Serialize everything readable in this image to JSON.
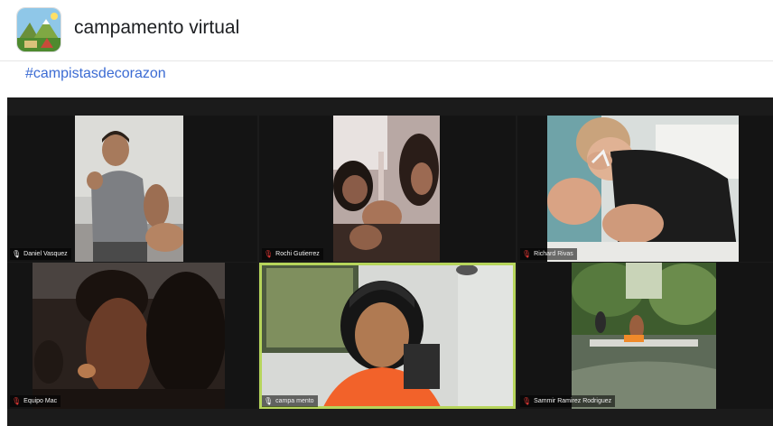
{
  "page": {
    "title": "campamento virtual",
    "hashtag": "#campistasdecorazon",
    "avatar_icon": "campsite-logo-icon"
  },
  "meeting": {
    "participants": [
      {
        "name": "Daniel Vasquez",
        "muted": false,
        "active": false
      },
      {
        "name": "Rochi Gutierrez",
        "muted": true,
        "active": false
      },
      {
        "name": "Richard Rivas",
        "muted": true,
        "active": false
      },
      {
        "name": "Equipo Mac",
        "muted": true,
        "active": false
      },
      {
        "name": "campa mento",
        "muted": false,
        "active": true
      },
      {
        "name": "Sammir Ramirez Rodriguez",
        "muted": true,
        "active": false
      }
    ],
    "active_speaker_color": "#b6d55b",
    "muted_color": "#e53935"
  }
}
